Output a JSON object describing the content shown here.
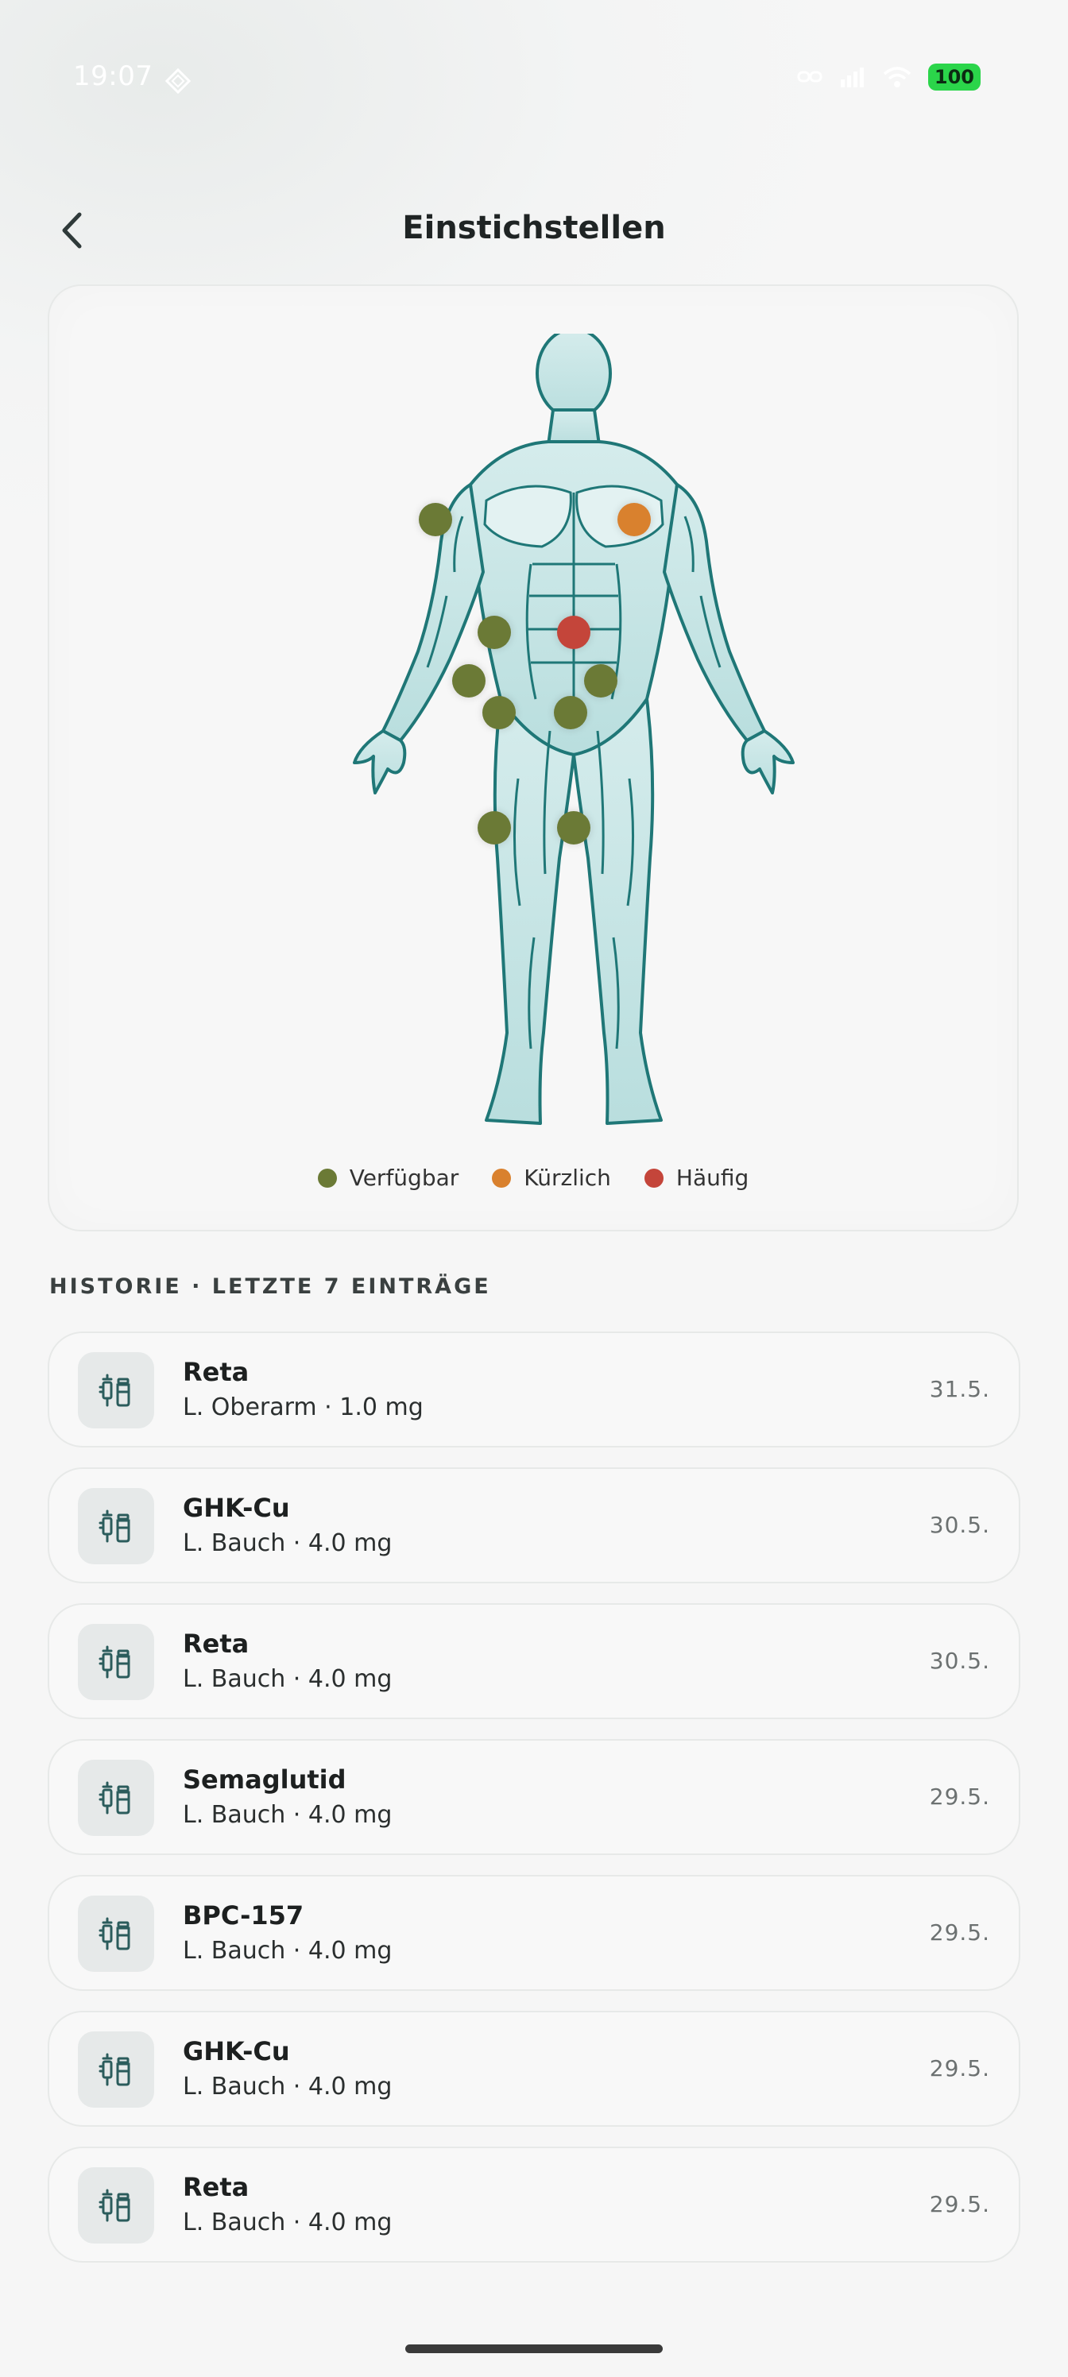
{
  "status": {
    "time": "19:07",
    "battery": "100"
  },
  "header": {
    "title": "Einstichstellen"
  },
  "colors": {
    "available": "#6b7a36",
    "recent": "#d9812e",
    "frequent": "#c4453a",
    "accent": "#2a8a8a"
  },
  "legend": {
    "available": "Verfügbar",
    "recent": "Kürzlich",
    "frequent": "Häufig"
  },
  "sites": [
    {
      "status": "available"
    },
    {
      "status": "recent"
    },
    {
      "status": "available"
    },
    {
      "status": "frequent"
    },
    {
      "status": "available"
    },
    {
      "status": "available"
    },
    {
      "status": "available"
    },
    {
      "status": "available"
    },
    {
      "status": "available"
    },
    {
      "status": "available"
    }
  ],
  "history": {
    "heading": "HISTORIE · LETZTE 7 EINTRÄGE",
    "entries": [
      {
        "name": "Reta",
        "detail": "L. Oberarm · 1.0 mg",
        "date": "31.5."
      },
      {
        "name": "GHK-Cu",
        "detail": "L. Bauch · 4.0 mg",
        "date": "30.5."
      },
      {
        "name": "Reta",
        "detail": "L. Bauch · 4.0 mg",
        "date": "30.5."
      },
      {
        "name": "Semaglutid",
        "detail": "L. Bauch · 4.0 mg",
        "date": "29.5."
      },
      {
        "name": "BPC-157",
        "detail": "L. Bauch · 4.0 mg",
        "date": "29.5."
      },
      {
        "name": "GHK-Cu",
        "detail": "L. Bauch · 4.0 mg",
        "date": "29.5."
      },
      {
        "name": "Reta",
        "detail": "L. Bauch · 4.0 mg",
        "date": "29.5."
      }
    ]
  }
}
